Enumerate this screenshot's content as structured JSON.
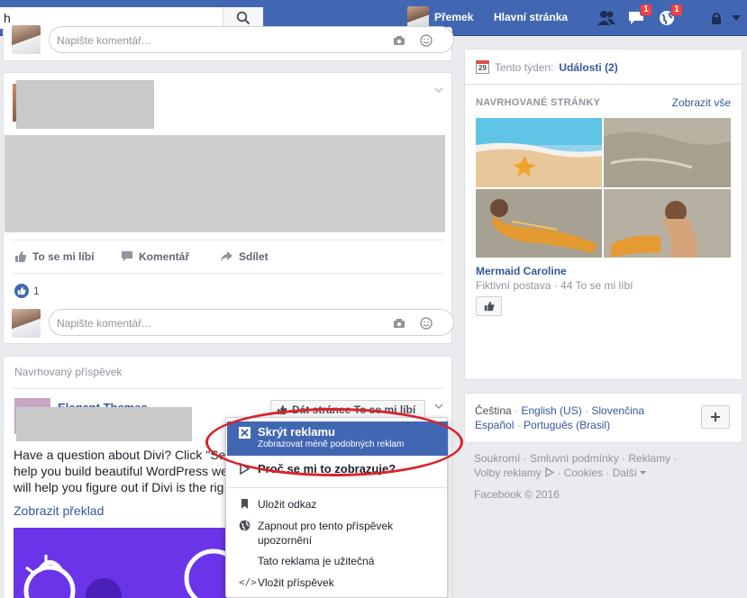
{
  "topbar": {
    "search_value": "h",
    "user_name": "Přemek",
    "home_label": "Hlavní stránka",
    "messages_badge": "1",
    "notifications_badge": "1"
  },
  "post1": {
    "comment_placeholder": "Napište komentář..."
  },
  "post2": {
    "actions": {
      "like": "To se mi líbí",
      "comment": "Komentář",
      "share": "Sdílet"
    },
    "like_count": "1",
    "comment_placeholder": "Napište komentář..."
  },
  "suggested_post": {
    "header": "Navrhovaný příspěvek",
    "page_name": "Elegant Themes",
    "like_page_button": "Dát stránce To se mi líbí",
    "body_line1": "Have a question about Divi? Click \"Se",
    "body_line2": "help you build beautiful WordPress we",
    "body_line3": "will help you figure out if Divi is the rig",
    "translate_link": "Zobrazit překlad"
  },
  "menu": {
    "hide_ad_title": "Skrýt reklamu",
    "hide_ad_sub": "Zobrazovat méně podobných reklam",
    "why_label": "Proč se mi to zobrazuje?",
    "save_link": "Uložit odkaz",
    "notifications_line1": "Zapnout pro tento příspěvek",
    "notifications_line2": "upozornění",
    "useful": "Tato reklama je užitečná",
    "embed": "Vložit příspěvek"
  },
  "right": {
    "events_prefix": "Tento týden:",
    "events_link": "Události (2)",
    "calendar_day": "29",
    "suggested_header": "NAVRHOVANÉ STRÁNKY",
    "see_all": "Zobrazit vše",
    "page_name": "Mermaid Caroline",
    "page_meta": "Fiktivní postava · 44 To se mi líbí",
    "languages": {
      "current": "Čeština",
      "english": "English (US)",
      "slovak": "Slovenčina",
      "spanish": "Español",
      "portuguese": "Português (Brasil)"
    },
    "footer": {
      "line1": "Soukromí · Smluvní podmínky · Reklamy ·",
      "line2": "Volby reklamy",
      "line2b": "· Cookies · Další",
      "copyright": "Facebook © 2016"
    }
  },
  "colors": {
    "topbar": "#4267b2",
    "link": "#365899",
    "highlight": "#4267b2",
    "annotation": "#d9232b"
  }
}
